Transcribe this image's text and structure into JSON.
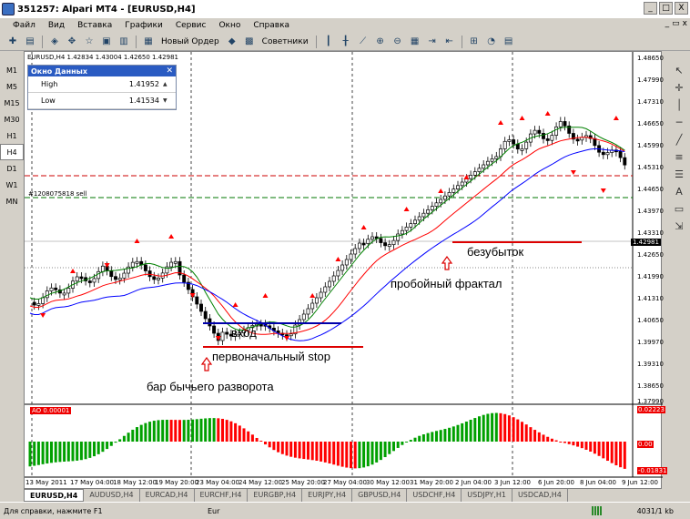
{
  "window": {
    "title": "351257: Alpari MT4 - [EURUSD,H4]",
    "min": "_",
    "max": "□",
    "close": "X"
  },
  "menu": [
    "Файл",
    "Вид",
    "Вставка",
    "Графики",
    "Сервис",
    "Окно",
    "Справка"
  ],
  "toolbar": {
    "new_order": "Новый Ордер",
    "experts": "Советники"
  },
  "timeframes": [
    "M1",
    "M5",
    "M15",
    "M30",
    "H1",
    "H4",
    "D1",
    "W1",
    "MN"
  ],
  "active_timeframe": "H4",
  "chart": {
    "ohlc_text": "EURUSD,H4 1.42834 1.43004 1.42650 1.42981",
    "order_label": "#1208075818 sell",
    "current_price": "1.42981",
    "price_scale": [
      "1.48650",
      "1.47990",
      "1.47310",
      "1.46650",
      "1.45990",
      "1.45310",
      "1.44650",
      "1.43970",
      "1.43310",
      "1.42650",
      "1.41990",
      "1.41310",
      "1.40650",
      "1.39970",
      "1.39310",
      "1.38650",
      "1.37990"
    ],
    "indicator_label": "AO 0.00001",
    "indicator_scale": [
      "0.02223",
      "0.00",
      "-0.01831"
    ],
    "date_scale": [
      "13 May 2011",
      "17 May 04:00",
      "18 May 12:00",
      "19 May 20:00",
      "23 May 04:00",
      "24 May 12:00",
      "25 May 20:00",
      "27 May 04:00",
      "30 May 12:00",
      "31 May 20:00",
      "2 Jun 04:00",
      "3 Jun 12:00",
      "6 Jun 20:00",
      "8 Jun 04:00",
      "9 Jun 12:00"
    ],
    "annotations": {
      "entry": "вход",
      "initial_stop": "первоначальный stop",
      "bullish_bar": "бар бычьего разворота",
      "breakout_fractal": "пробойный фрактал",
      "breakeven": "безубыток"
    }
  },
  "data_window": {
    "title": "Окно Данных",
    "rows": [
      {
        "label": "High",
        "value": "1.41952"
      },
      {
        "label": "Low",
        "value": "1.41534"
      }
    ]
  },
  "tabs": [
    "EURUSD,H4",
    "AUDUSD,H4",
    "EURCAD,H4",
    "EURCHF,H4",
    "EURGBP,H4",
    "EURJPY,H4",
    "GBPUSD,H4",
    "USDCHF,H4",
    "USDJPY,H1",
    "USDCAD,H4"
  ],
  "status": {
    "help": "Для справки, нажмите F1",
    "profile": "Eur",
    "traffic": "4031/1 kb"
  },
  "colors": {
    "bull": "#000000",
    "bear": "#000000",
    "fractal": "#ff0000",
    "ma_green": "#008000",
    "ma_red": "#ff0000",
    "ma_blue": "#0000ff",
    "ao_up": "#00a000",
    "ao_down": "#ff0000"
  }
}
